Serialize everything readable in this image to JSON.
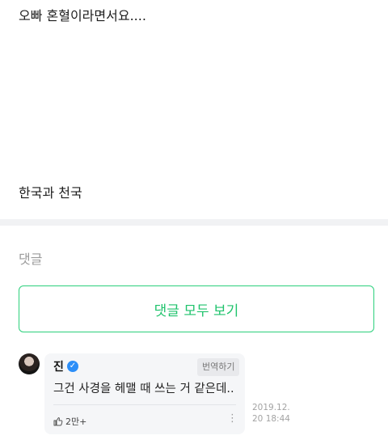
{
  "post": {
    "line1": "오빠 혼혈이라면서요....",
    "line2": "한국과 천국"
  },
  "comments_section": {
    "heading": "댓글",
    "view_all_label": "댓글 모두 보기"
  },
  "comment": {
    "author": "진",
    "verified_icon": "verified-check-icon",
    "translate_label": "번역하기",
    "text": "그건 사경을 헤맬 때 쓰는 거 같은데..",
    "like_count": "2만+",
    "like_icon": "thumbs-up-icon",
    "more_icon": "more-vertical-icon",
    "timestamp": "2019.12.20 18:44"
  },
  "colors": {
    "accent": "#2cd07c",
    "verified": "#2c8ef8"
  }
}
